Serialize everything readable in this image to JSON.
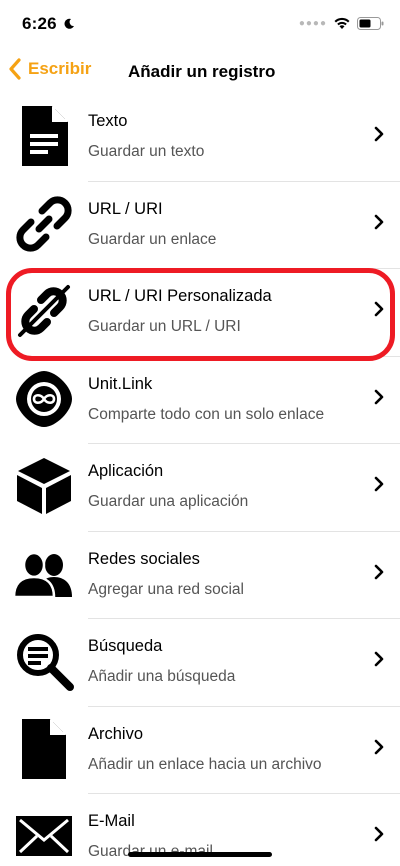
{
  "status_bar": {
    "time": "6:26"
  },
  "nav": {
    "back_label": "Escribir",
    "title": "Añadir un registro"
  },
  "items": [
    {
      "title": "Texto",
      "subtitle": "Guardar un texto",
      "icon": "document-icon"
    },
    {
      "title": "URL / URI",
      "subtitle": "Guardar un enlace",
      "icon": "link-icon"
    },
    {
      "title": "URL / URI Personalizada",
      "subtitle": "Guardar un URL / URI",
      "icon": "custom-link-icon"
    },
    {
      "title": "Unit.Link",
      "subtitle": "Comparte todo con un solo enlace",
      "icon": "unit-link-icon"
    },
    {
      "title": "Aplicación",
      "subtitle": "Guardar una aplicación",
      "icon": "cube-icon"
    },
    {
      "title": "Redes sociales",
      "subtitle": "Agregar una red social",
      "icon": "people-icon"
    },
    {
      "title": "Búsqueda",
      "subtitle": "Añadir una búsqueda",
      "icon": "search-icon"
    },
    {
      "title": "Archivo",
      "subtitle": "Añadir un enlace hacia un archivo",
      "icon": "file-icon"
    },
    {
      "title": "E-Mail",
      "subtitle": "Guardar un e-mail",
      "icon": "envelope-icon"
    }
  ],
  "colors": {
    "accent": "#f5a214",
    "highlight": "#ee1b24"
  }
}
